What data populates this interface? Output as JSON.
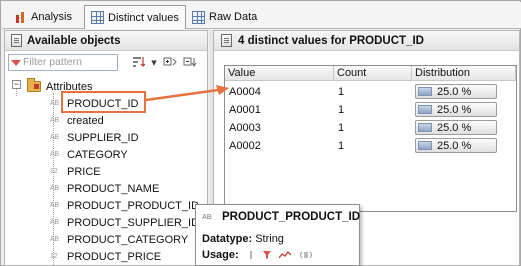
{
  "tabs": [
    {
      "label": "Analysis",
      "icon": "bar-chart-icon",
      "active": false
    },
    {
      "label": "Distinct values",
      "icon": "table-icon",
      "active": true
    },
    {
      "label": "Raw Data",
      "icon": "table-icon",
      "active": false
    }
  ],
  "left_panel": {
    "title": "Available objects",
    "filter_placeholder": "Filter pattern",
    "folder_label": "Attributes",
    "expander": "−",
    "items": [
      {
        "type": "AB",
        "label": "PRODUCT_ID",
        "highlighted": true
      },
      {
        "type": "AB",
        "label": "created"
      },
      {
        "type": "AB",
        "label": "SUPPLIER_ID"
      },
      {
        "type": "AB",
        "label": "CATEGORY"
      },
      {
        "type": "12",
        "label": "PRICE"
      },
      {
        "type": "AB",
        "label": "PRODUCT_NAME"
      },
      {
        "type": "AB",
        "label": "PRODUCT_PRODUCT_ID"
      },
      {
        "type": "AB",
        "label": "PRODUCT_SUPPLIER_ID"
      },
      {
        "type": "AB",
        "label": "PRODUCT_CATEGORY"
      },
      {
        "type": "12",
        "label": "PRODUCT_PRICE"
      }
    ]
  },
  "right_panel": {
    "title": "4 distinct values for PRODUCT_ID",
    "columns": [
      "Value",
      "Count",
      "Distribution"
    ],
    "rows": [
      {
        "value": "A0004",
        "count": "1",
        "distribution": "25.0 %"
      },
      {
        "value": "A0001",
        "count": "1",
        "distribution": "25.0 %"
      },
      {
        "value": "A0003",
        "count": "1",
        "distribution": "25.0 %"
      },
      {
        "value": "A0002",
        "count": "1",
        "distribution": "25.0 %"
      }
    ]
  },
  "tooltip": {
    "type": "AB",
    "title": "PRODUCT_PRODUCT_ID",
    "datatype_label": "Datatype:",
    "datatype_value": "String",
    "usage_label": "Usage:"
  },
  "colors": {
    "accent": "#e8723f",
    "header_bg": "#e4e4e4"
  }
}
